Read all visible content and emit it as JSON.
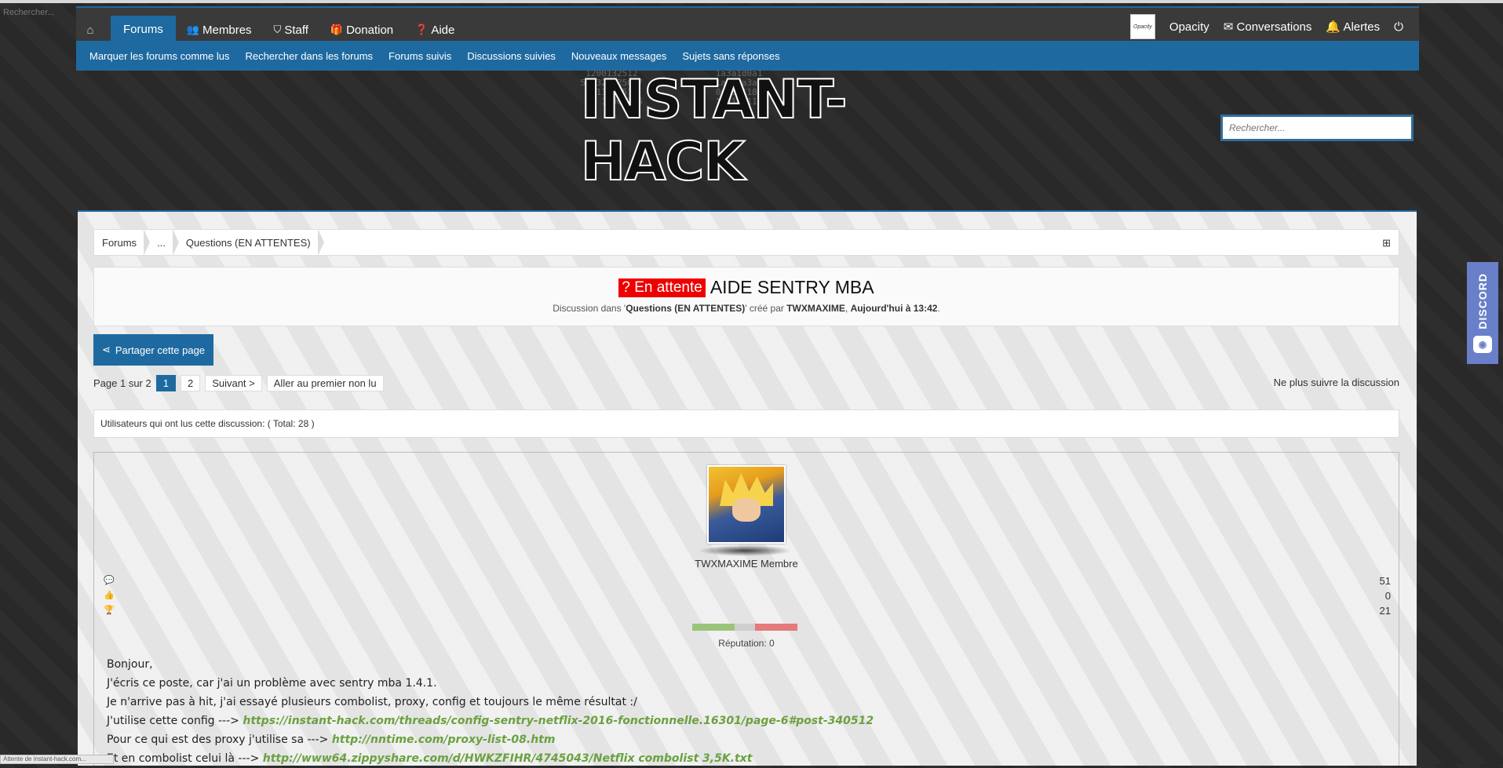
{
  "browser": {
    "status_text": "Attente de instant-hack.com...",
    "ghost_label": "Rechercher..."
  },
  "nav": {
    "home_icon": "home-icon",
    "forums_label": "Forums",
    "items": [
      {
        "label": "Membres",
        "icon": "members-icon"
      },
      {
        "label": "Staff",
        "icon": "shield-icon"
      },
      {
        "label": "Donation",
        "icon": "gift-icon"
      },
      {
        "label": "Aide",
        "icon": "help-icon"
      }
    ],
    "user_name": "Opacity",
    "user_avatar_text": "Opacity",
    "conversations_label": "Conversations",
    "alerts_label": "Alertes"
  },
  "subnav": [
    "Marquer les forums comme lus",
    "Rechercher dans les forums",
    "Forums suivis",
    "Discussions suivies",
    "Nouveaux messages",
    "Sujets sans réponses"
  ],
  "header": {
    "logo_text": "INSTANT-HACK",
    "search_placeholder": "Rechercher..."
  },
  "breadcrumb": [
    "Forums",
    "...",
    "Questions (EN ATTENTES)"
  ],
  "thread": {
    "prefix": "? En attente",
    "title": "AIDE SENTRY MBA",
    "meta_prefix": "Discussion dans '",
    "meta_forum": "Questions (EN ATTENTES)",
    "meta_mid": "' créé par ",
    "meta_author": "TWXMAXIME",
    "meta_sep": ", ",
    "meta_date": "Aujourd'hui à 13:42",
    "meta_end": "."
  },
  "share_label": "Partager cette page",
  "pagination": {
    "page_text": "Page 1 sur 2",
    "pages": [
      "1",
      "2"
    ],
    "next_label": "Suivant >",
    "first_unread_label": "Aller au premier non lu",
    "unfollow_label": "Ne plus suivre la discussion"
  },
  "readers_text": "Utilisateurs qui ont lus cette discussion: ( Total: 28 )",
  "post": {
    "author": "TWXMAXIME",
    "role": "Membre",
    "stats": {
      "messages": "51",
      "likes": "0",
      "trophies": "21"
    },
    "reputation_label": "Réputation: 0",
    "lines": [
      {
        "text": "Bonjour,"
      },
      {
        "text": "J'écris ce poste, car j'ai un problème avec sentry mba 1.4.1."
      },
      {
        "text": "Je n'arrive pas à hit, j'ai essayé plusieurs combolist, proxy, config et toujours le même résultat :/"
      },
      {
        "text": "J'utilise cette config ---> ",
        "link": "https://instant-hack.com/threads/config-sentry-netflix-2016-fonctionnelle.16301/page-6#post-340512"
      },
      {
        "text": "Pour ce qui est des proxy j'utilise sa ---> ",
        "link": "http://nntime.com/proxy-list-08.htm"
      },
      {
        "text": "Et en combolist celui là ---> ",
        "link": "http://www64.zippyshare.com/d/HWKZFIHR/4745043/Netflix combolist 3,5K.txt"
      }
    ]
  },
  "discord_label": "DISCORD",
  "colors": {
    "primary": "#1e6aa0",
    "prefix": "#e00000",
    "link": "#6aa13f"
  }
}
